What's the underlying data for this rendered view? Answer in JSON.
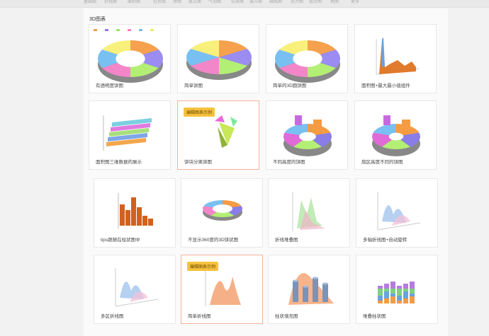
{
  "section": {
    "title": "3D图表"
  },
  "topnav": {
    "items": [
      "基础图",
      "折线图",
      "面积图",
      "柱状图",
      "饼图",
      "散点图",
      "气泡图",
      "仪表图",
      "漏斗图",
      "箱线图",
      "热力图",
      "组合图",
      "地图",
      "更多"
    ]
  },
  "badge_label": "编辑图表示例",
  "cards": [
    {
      "title": "有透明度饼图",
      "kind": "donut"
    },
    {
      "title": "简单饼图",
      "kind": "pie"
    },
    {
      "title": "简单的3D圆饼图",
      "kind": "donut2"
    },
    {
      "title": "面积图+最大最小值组件",
      "kind": "area"
    },
    {
      "title": "面积图三维数据的展示",
      "kind": "ribbon"
    },
    {
      "title": "饼块分离饼图",
      "kind": "explode",
      "badge": true
    },
    {
      "title": "不同高度的饼图",
      "kind": "heightpie"
    },
    {
      "title": "扇区高度不同的饼图",
      "kind": "heightpie2"
    },
    {
      "title": "tips跟随在柱状图中",
      "kind": "bars"
    },
    {
      "title": "不显示360度的3D饼状图",
      "kind": "flatpie"
    },
    {
      "title": "折线堆叠图",
      "kind": "layers"
    },
    {
      "title": "多轴折线图+自动旋转",
      "kind": "multi"
    },
    {
      "title": "多区折线图",
      "kind": "multi2"
    },
    {
      "title": "简单折线图",
      "kind": "curve",
      "badge": true
    },
    {
      "title": "柱状填充图",
      "kind": "cyl"
    },
    {
      "title": "堆叠柱状图",
      "kind": "stack"
    }
  ]
}
